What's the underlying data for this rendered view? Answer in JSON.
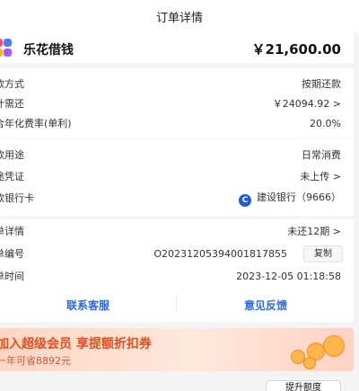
{
  "header": {
    "title": "订单详情"
  },
  "product": {
    "name": "乐花借钱",
    "amount": "￥21,600.00"
  },
  "loan": {
    "rows": [
      {
        "label": "款方式",
        "value": "按期还款"
      },
      {
        "label": "计需还",
        "value": "￥24094.92 >"
      },
      {
        "label": "合年化费率(单利)",
        "value": "20.0%"
      }
    ]
  },
  "usage": {
    "rows": [
      {
        "label": "款用途",
        "value": "日常消费"
      },
      {
        "label": "途凭证",
        "value": "未上传 >"
      },
      {
        "label": "款银行卡",
        "value": "建设银行（9666）"
      }
    ],
    "bank_icon": "ccb-bank-icon"
  },
  "order": {
    "rows": [
      {
        "label": "单详情",
        "value": "未还12期 >"
      },
      {
        "label": "单编号",
        "value": "O20231205394001817855"
      },
      {
        "label": "单时间",
        "value": "2023-12-05 01:18:58"
      }
    ],
    "copy_label": "复制"
  },
  "actions": {
    "contact": "联系客服",
    "feedback": "意见反馈"
  },
  "banner": {
    "title": "加入超级会员 享提额折扣券",
    "subtitle": "一年可省8892元"
  },
  "raise_limit": "提升额度",
  "colors": {
    "accent_blue": "#2d6ae3",
    "banner_orange": "#e0501e",
    "bank_blue": "#1e5bd9"
  }
}
